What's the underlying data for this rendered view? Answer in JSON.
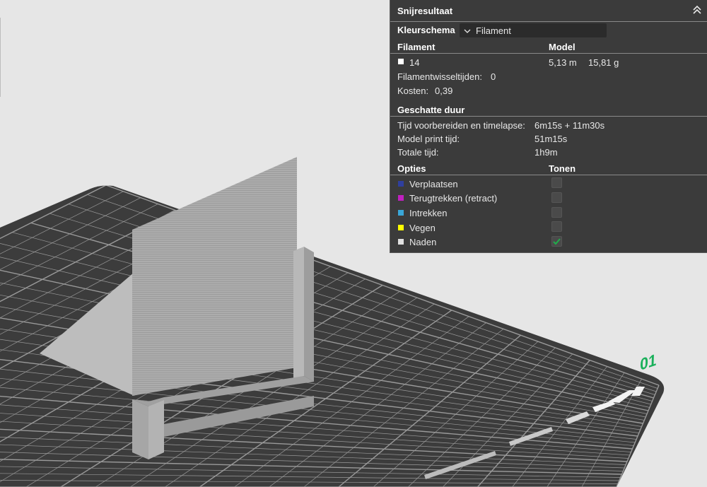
{
  "panel": {
    "title": "Snijresultaat",
    "color_scheme_label": "Kleurschema",
    "color_scheme_value": "Filament",
    "filament_header": "Filament",
    "model_header": "Model",
    "filament": {
      "id": "14",
      "length": "5,13 m",
      "weight": "15,81 g",
      "swatch_color": "#ffffff"
    },
    "filament_changes_label": "Filamentwisseltijden:",
    "filament_changes_value": "0",
    "cost_label": "Kosten:",
    "cost_value": "0,39",
    "duration_header": "Geschatte duur",
    "prep_label": "Tijd voorbereiden en timelapse:",
    "prep_value": "6m15s + 11m30s",
    "model_time_label": "Model print tijd:",
    "model_time_value": "51m15s",
    "total_label": "Totale tijd:",
    "total_value": "1h9m",
    "options_header": "Opties",
    "show_header": "Tonen",
    "options": [
      {
        "label": "Verplaatsen",
        "color": "#2f3f9e",
        "checked": false
      },
      {
        "label": "Terugtrekken (retract)",
        "color": "#c020c0",
        "checked": false
      },
      {
        "label": "Intrekken",
        "color": "#3aa7d8",
        "checked": false
      },
      {
        "label": "Vegen",
        "color": "#ffff00",
        "checked": false
      },
      {
        "label": "Naden",
        "color": "#e0e0e0",
        "checked": true
      }
    ]
  },
  "plate": {
    "number": "01",
    "number_color": "#19b05a"
  },
  "colors": {
    "plate": "#3c3c3c",
    "grid": "#9a9a9a",
    "model": "#a9a9a9",
    "background": "#e6e6e6",
    "check": "#1fae4a"
  }
}
